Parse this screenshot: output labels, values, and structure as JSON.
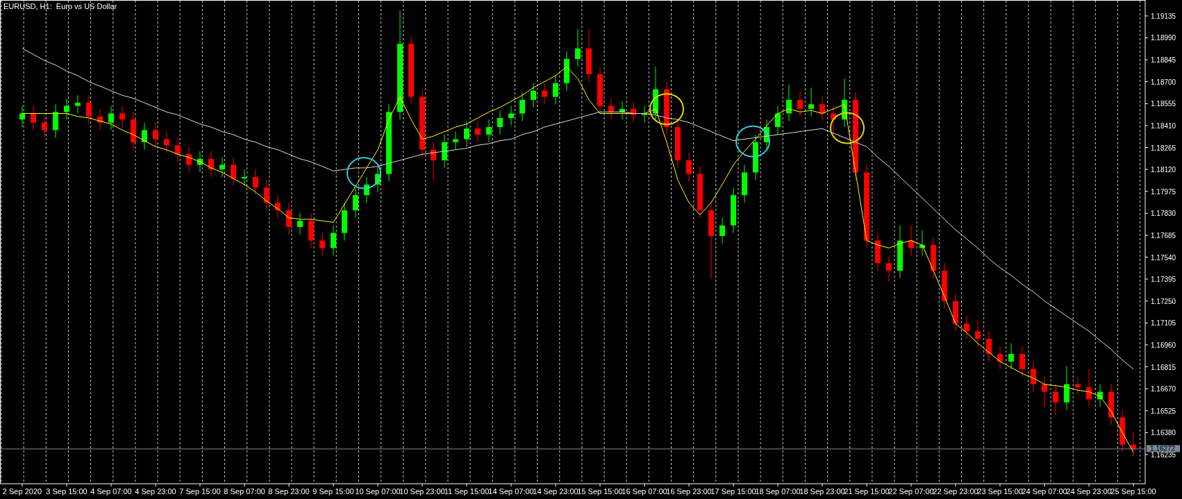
{
  "chart": {
    "title": "EURUSD, H1:  Euro vs US Dollar",
    "chart_data": {
      "type": "candlestick",
      "grid": true,
      "categories": [
        "2 Sep 2020",
        null,
        null,
        null,
        "3 Sep 15:00",
        null,
        null,
        null,
        "4 Sep 07:00",
        null,
        null,
        null,
        "4 Sep 23:00",
        null,
        null,
        null,
        "7 Sep 15:00",
        null,
        null,
        null,
        "8 Sep 07:00",
        null,
        null,
        null,
        "8 Sep 23:00",
        null,
        null,
        null,
        "9 Sep 15:00",
        null,
        null,
        null,
        "10 Sep 07:00",
        null,
        null,
        null,
        "10 Sep 23:00",
        null,
        null,
        null,
        "11 Sep 15:00",
        null,
        null,
        null,
        "14 Sep 07:00",
        null,
        null,
        null,
        "14 Sep 23:00",
        null,
        null,
        null,
        "15 Sep 15:00",
        null,
        null,
        null,
        "16 Sep 07:00",
        null,
        null,
        null,
        "16 Sep 23:00",
        null,
        null,
        null,
        "17 Sep 15:00",
        null,
        null,
        null,
        "18 Sep 07:00",
        null,
        null,
        null,
        "18 Sep 23:00",
        null,
        null,
        null,
        "21 Sep 15:00",
        null,
        null,
        null,
        "22 Sep 07:00",
        null,
        null,
        null,
        "22 Sep 23:00",
        null,
        null,
        null,
        "23 Sep 15:00",
        null,
        null,
        null,
        "24 Sep 07:00",
        null,
        null,
        null,
        "24 Sep 23:00",
        null,
        null,
        null,
        "25 Sep 15:00"
      ],
      "ohlc": [
        [
          1.1845,
          1.1854,
          1.184,
          1.1849
        ],
        [
          1.1849,
          1.1854,
          1.1838,
          1.1843
        ],
        [
          1.1843,
          1.1848,
          1.1833,
          1.1838
        ],
        [
          1.1838,
          1.1855,
          1.1833,
          1.185
        ],
        [
          1.185,
          1.1859,
          1.1845,
          1.1854
        ],
        [
          1.1854,
          1.1861,
          1.1849,
          1.1856
        ],
        [
          1.1856,
          1.1861,
          1.1842,
          1.1847
        ],
        [
          1.1847,
          1.1852,
          1.1838,
          1.1843
        ],
        [
          1.1843,
          1.1854,
          1.1838,
          1.1849
        ],
        [
          1.1849,
          1.1854,
          1.184,
          1.1845
        ],
        [
          1.1845,
          1.185,
          1.1825,
          1.183
        ],
        [
          1.183,
          1.1843,
          1.1825,
          1.1838
        ],
        [
          1.1838,
          1.1843,
          1.1827,
          1.1832
        ],
        [
          1.1832,
          1.1837,
          1.1823,
          1.1828
        ],
        [
          1.1828,
          1.1833,
          1.1817,
          1.1822
        ],
        [
          1.1822,
          1.1827,
          1.181,
          1.1815
        ],
        [
          1.1815,
          1.1824,
          1.181,
          1.1819
        ],
        [
          1.1819,
          1.1824,
          1.1807,
          1.1812
        ],
        [
          1.1812,
          1.182,
          1.1807,
          1.1815
        ],
        [
          1.1815,
          1.182,
          1.1801,
          1.1806
        ],
        [
          1.1806,
          1.1812,
          1.1801,
          1.1807
        ],
        [
          1.1807,
          1.1812,
          1.1795,
          1.18
        ],
        [
          1.18,
          1.1805,
          1.1785,
          1.179
        ],
        [
          1.179,
          1.1795,
          1.178,
          1.1785
        ],
        [
          1.1785,
          1.179,
          1.1769,
          1.1774
        ],
        [
          1.1774,
          1.1783,
          1.1769,
          1.1778
        ],
        [
          1.1778,
          1.1783,
          1.176,
          1.1765
        ],
        [
          1.1765,
          1.177,
          1.1755,
          1.176
        ],
        [
          1.176,
          1.1775,
          1.1755,
          1.177
        ],
        [
          1.177,
          1.179,
          1.1765,
          1.1785
        ],
        [
          1.1785,
          1.18,
          1.178,
          1.1795
        ],
        [
          1.1795,
          1.1807,
          1.179,
          1.1802
        ],
        [
          1.1802,
          1.1814,
          1.1797,
          1.1809
        ],
        [
          1.1809,
          1.1855,
          1.1804,
          1.185
        ],
        [
          1.185,
          1.1917,
          1.1845,
          1.1895
        ],
        [
          1.1895,
          1.19,
          1.1855,
          1.186
        ],
        [
          1.186,
          1.1865,
          1.182,
          1.1825
        ],
        [
          1.1825,
          1.183,
          1.1805,
          1.1818
        ],
        [
          1.1818,
          1.1835,
          1.1813,
          1.183
        ],
        [
          1.183,
          1.1837,
          1.1825,
          1.1832
        ],
        [
          1.1832,
          1.1844,
          1.1827,
          1.1839
        ],
        [
          1.1839,
          1.1844,
          1.183,
          1.1835
        ],
        [
          1.1835,
          1.1845,
          1.183,
          1.184
        ],
        [
          1.184,
          1.1851,
          1.1835,
          1.1846
        ],
        [
          1.1846,
          1.1854,
          1.1841,
          1.1849
        ],
        [
          1.1849,
          1.1863,
          1.1844,
          1.1858
        ],
        [
          1.1858,
          1.1869,
          1.1853,
          1.1864
        ],
        [
          1.1864,
          1.1869,
          1.1855,
          1.186
        ],
        [
          1.186,
          1.1874,
          1.1855,
          1.1869
        ],
        [
          1.1869,
          1.189,
          1.1864,
          1.1885
        ],
        [
          1.1885,
          1.1905,
          1.188,
          1.1892
        ],
        [
          1.1892,
          1.1905,
          1.187,
          1.1875
        ],
        [
          1.1875,
          1.188,
          1.1849,
          1.1854
        ],
        [
          1.1854,
          1.1859,
          1.1845,
          1.185
        ],
        [
          1.185,
          1.1857,
          1.1845,
          1.1852
        ],
        [
          1.1852,
          1.1857,
          1.1843,
          1.1848
        ],
        [
          1.1848,
          1.1854,
          1.1843,
          1.1849
        ],
        [
          1.1849,
          1.188,
          1.1844,
          1.1865
        ],
        [
          1.1865,
          1.187,
          1.1835,
          1.184
        ],
        [
          1.184,
          1.1845,
          1.1813,
          1.1818
        ],
        [
          1.1818,
          1.1823,
          1.1804,
          1.1809
        ],
        [
          1.1809,
          1.1814,
          1.178,
          1.1785
        ],
        [
          1.1785,
          1.179,
          1.174,
          1.1768
        ],
        [
          1.1768,
          1.178,
          1.1763,
          1.1775
        ],
        [
          1.1775,
          1.18,
          1.177,
          1.1795
        ],
        [
          1.1795,
          1.1815,
          1.179,
          1.181
        ],
        [
          1.181,
          1.1835,
          1.1805,
          1.183
        ],
        [
          1.183,
          1.1845,
          1.1825,
          1.184
        ],
        [
          1.184,
          1.1854,
          1.1835,
          1.1849
        ],
        [
          1.1849,
          1.1868,
          1.1844,
          1.1858
        ],
        [
          1.1858,
          1.1863,
          1.1847,
          1.1852
        ],
        [
          1.1852,
          1.1866,
          1.1847,
          1.1855
        ],
        [
          1.1855,
          1.186,
          1.1844,
          1.1849
        ],
        [
          1.1849,
          1.1854,
          1.1835,
          1.1845
        ],
        [
          1.1845,
          1.1872,
          1.184,
          1.1858
        ],
        [
          1.1858,
          1.1863,
          1.1805,
          1.181
        ],
        [
          1.181,
          1.1815,
          1.176,
          1.1765
        ],
        [
          1.1765,
          1.177,
          1.1745,
          1.175
        ],
        [
          1.175,
          1.1755,
          1.1738,
          1.1745
        ],
        [
          1.1745,
          1.1775,
          1.174,
          1.1765
        ],
        [
          1.1765,
          1.1775,
          1.1755,
          1.176
        ],
        [
          1.176,
          1.1772,
          1.1755,
          1.1762
        ],
        [
          1.1762,
          1.1767,
          1.174,
          1.1745
        ],
        [
          1.1745,
          1.175,
          1.172,
          1.1725
        ],
        [
          1.1725,
          1.173,
          1.1705,
          1.171
        ],
        [
          1.171,
          1.1715,
          1.17,
          1.1705
        ],
        [
          1.1705,
          1.1712,
          1.1695,
          1.17
        ],
        [
          1.17,
          1.1705,
          1.1685,
          1.169
        ],
        [
          1.169,
          1.1695,
          1.168,
          1.1685
        ],
        [
          1.1685,
          1.1697,
          1.168,
          1.169
        ],
        [
          1.169,
          1.1695,
          1.1675,
          1.168
        ],
        [
          1.168,
          1.1685,
          1.1665,
          1.167
        ],
        [
          1.167,
          1.1675,
          1.1655,
          1.1665
        ],
        [
          1.1665,
          1.167,
          1.165,
          1.1658
        ],
        [
          1.1658,
          1.1682,
          1.1653,
          1.167
        ],
        [
          1.167,
          1.1675,
          1.1663,
          1.1668
        ],
        [
          1.1668,
          1.168,
          1.1655,
          1.166
        ],
        [
          1.166,
          1.167,
          1.1655,
          1.1665
        ],
        [
          1.1665,
          1.167,
          1.1643,
          1.1648
        ],
        [
          1.1648,
          1.1653,
          1.1625,
          1.163
        ],
        [
          1.163,
          1.1638,
          1.1622,
          1.1627
        ]
      ],
      "series": [
        {
          "type": "line",
          "color": "#ffff00",
          "values": [
            1.1849,
            1.1849,
            1.1849,
            1.1849,
            1.1849,
            1.1847,
            1.1846,
            1.1844,
            1.1842,
            1.1838,
            1.1835,
            1.1831,
            1.1827,
            1.1825,
            1.1822,
            1.182,
            1.1817,
            1.1813,
            1.181,
            1.1806,
            1.1802,
            1.1797,
            1.1791,
            1.1786,
            1.178,
            1.1779,
            1.1779,
            1.1778,
            1.1777,
            1.1789,
            1.1801,
            1.1813,
            1.1825,
            1.1845,
            1.186,
            1.1845,
            1.1832,
            1.1834,
            1.1837,
            1.184,
            1.1842,
            1.1846,
            1.185,
            1.1853,
            1.1857,
            1.1861,
            1.1866,
            1.187,
            1.1874,
            1.188,
            1.1872,
            1.1858,
            1.1849,
            1.1849,
            1.1849,
            1.1849,
            1.1849,
            1.1852,
            1.183,
            1.1805,
            1.179,
            1.1782,
            1.179,
            1.1802,
            1.1815,
            1.1824,
            1.1832,
            1.1841,
            1.1849,
            1.1852,
            1.185,
            1.1851,
            1.1849,
            1.1852,
            1.1855,
            1.181,
            1.1765,
            1.1762,
            1.176,
            1.1763,
            1.1765,
            1.1762,
            1.1745,
            1.1728,
            1.171,
            1.1704,
            1.1697,
            1.1691,
            1.1685,
            1.1681,
            1.1677,
            1.1674,
            1.167,
            1.1669,
            1.1668,
            1.1666,
            1.1665,
            1.1662,
            1.1652,
            1.1638,
            1.1625
          ]
        },
        {
          "type": "line",
          "color": "#dcdcdc",
          "values": [
            1.1892,
            1.1888,
            1.1884,
            1.1881,
            1.1877,
            1.1874,
            1.187,
            1.1867,
            1.1864,
            1.1861,
            1.1859,
            1.1856,
            1.1853,
            1.185,
            1.1848,
            1.1845,
            1.1842,
            1.184,
            1.1837,
            1.1835,
            1.1832,
            1.183,
            1.1827,
            1.1825,
            1.1822,
            1.1819,
            1.1817,
            1.1814,
            1.1811,
            1.1812,
            1.1813,
            1.1813,
            1.1814,
            1.1816,
            1.1818,
            1.182,
            1.1822,
            1.1823,
            1.1824,
            1.1825,
            1.1826,
            1.1828,
            1.1829,
            1.1831,
            1.1832,
            1.1835,
            1.1837,
            1.184,
            1.1842,
            1.1844,
            1.1846,
            1.1848,
            1.185,
            1.185,
            1.185,
            1.1849,
            1.1849,
            1.1848,
            1.1846,
            1.1845,
            1.1843,
            1.184,
            1.1837,
            1.1834,
            1.1831,
            1.1832,
            1.1833,
            1.1834,
            1.1835,
            1.1836,
            1.1837,
            1.1838,
            1.1839,
            1.1836,
            1.1833,
            1.183,
            1.1827,
            1.182,
            1.1814,
            1.1807,
            1.18,
            1.1793,
            1.1786,
            1.1779,
            1.1772,
            1.1766,
            1.176,
            1.1753,
            1.1747,
            1.1742,
            1.1736,
            1.1731,
            1.1725,
            1.172,
            1.1715,
            1.171,
            1.1705,
            1.1699,
            1.1693,
            1.1686,
            1.168
          ]
        }
      ],
      "ref_lines": [
        {
          "axis": "y",
          "value": 1.16272,
          "label": "1.16272"
        }
      ],
      "ylim": [
        1.16042,
        1.1924
      ],
      "yticks": [
        {
          "value": 1.19135,
          "label": "1.19135"
        },
        {
          "value": 1.1899,
          "label": "1.18990"
        },
        {
          "value": 1.18845,
          "label": "1.18845"
        },
        {
          "value": 1.187,
          "label": "1.18700"
        },
        {
          "value": 1.18555,
          "label": "1.18555"
        },
        {
          "value": 1.1841,
          "label": "1.18410"
        },
        {
          "value": 1.18265,
          "label": "1.18265"
        },
        {
          "value": 1.1812,
          "label": "1.18120"
        },
        {
          "value": 1.17975,
          "label": "1.17975"
        },
        {
          "value": 1.1783,
          "label": "1.17830"
        },
        {
          "value": 1.17685,
          "label": "1.17685"
        },
        {
          "value": 1.1754,
          "label": "1.17540"
        },
        {
          "value": 1.17395,
          "label": "1.17395"
        },
        {
          "value": 1.1725,
          "label": "1.17250"
        },
        {
          "value": 1.17105,
          "label": "1.17105"
        },
        {
          "value": 1.1696,
          "label": "1.16960"
        },
        {
          "value": 1.16815,
          "label": "1.16815"
        },
        {
          "value": 1.1667,
          "label": "1.16670"
        },
        {
          "value": 1.16525,
          "label": "1.16525"
        },
        {
          "value": 1.1638,
          "label": "1.16380"
        },
        {
          "value": 1.16235,
          "label": "1.16235"
        }
      ]
    },
    "circles": [
      {
        "color": "#33ccdd"
      },
      {
        "color": "#e8d800"
      },
      {
        "color": "#33ccdd"
      },
      {
        "color": "#e8d800"
      }
    ]
  }
}
